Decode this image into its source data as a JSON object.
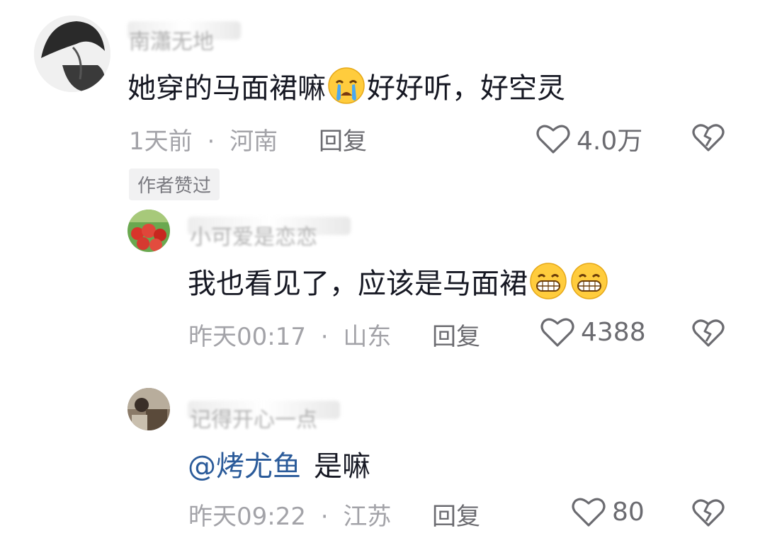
{
  "comments": [
    {
      "username": "南瀟无地",
      "text": "她穿的马面裙嘛",
      "text_after_emoji": "好好听，好空灵",
      "emoji": "crying-face",
      "time": "1天前",
      "location": "河南",
      "reply_label": "回复",
      "likes": "4.0万",
      "author_badge": "作者赞过"
    },
    {
      "username": "小可爱是恋恋",
      "text": "我也看见了，应该是马面裙",
      "emoji": "grinning-face",
      "time": "昨天00:17",
      "location": "山东",
      "reply_label": "回复",
      "likes": "4388"
    },
    {
      "username": "记得开心一点",
      "mention": "@烤尤鱼",
      "text": "是嘛",
      "time": "昨天09:22",
      "location": "江苏",
      "reply_label": "回复",
      "likes": "80"
    }
  ],
  "separator": "·",
  "colors": {
    "text": "#161823",
    "meta": "#a3a3a8",
    "mention": "#2b5b9a",
    "icon": "#6b6b70"
  }
}
